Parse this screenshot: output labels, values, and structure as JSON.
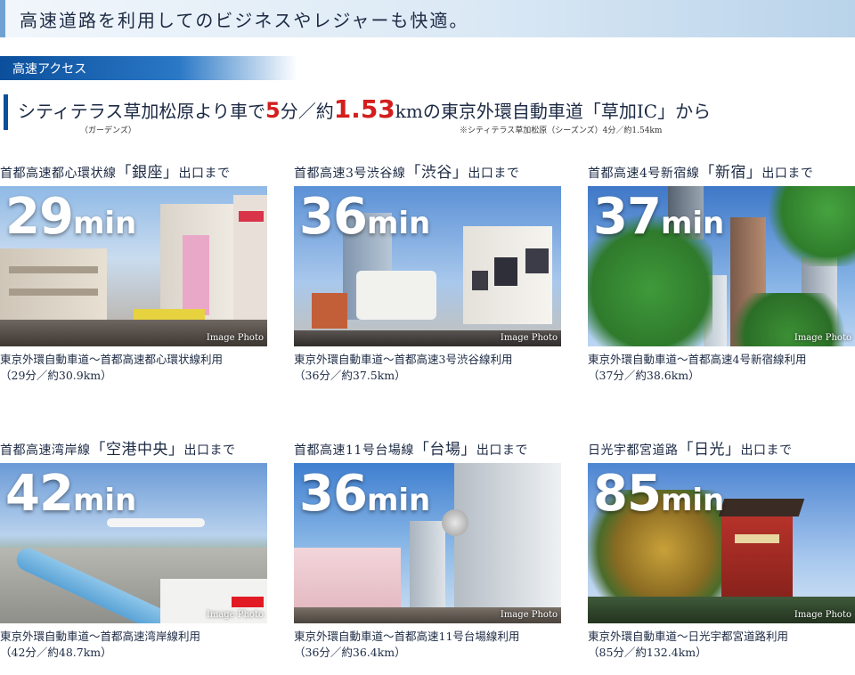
{
  "header": {
    "title": "高速道路を利用してのビジネスやレジャーも快適。"
  },
  "section": {
    "label": "高速アクセス"
  },
  "access": {
    "pre": "シティテラス草加松原より車で",
    "minutes": "5",
    "min_unit": "分／約",
    "km": "1.53",
    "post": "kmの東京外環自動車道「草加IC」から",
    "note_gardens": "（ガーデンズ）",
    "note_seasons": "※シティテラス草加松原（シーズンズ）4分／約1.54km"
  },
  "photo_tag": "Image Photo",
  "minute_unit": "min",
  "cards": [
    {
      "head_pre": "首都高速都心環状線",
      "head_big": "「銀座」",
      "head_post": "出口まで",
      "time": "29",
      "route": "東京外環自動車道～首都高速都心環状線利用",
      "detail": "（29分／約30.9km）"
    },
    {
      "head_pre": "首都高速3号渋谷線",
      "head_big": "「渋谷」",
      "head_post": "出口まで",
      "time": "36",
      "route": "東京外環自動車道～首都高速3号渋谷線利用",
      "detail": "（36分／約37.5km）"
    },
    {
      "head_pre": "首都高速4号新宿線",
      "head_big": "「新宿」",
      "head_post": "出口まで",
      "time": "37",
      "route": "東京外環自動車道～首都高速4号新宿線利用",
      "detail": "（37分／約38.6km）"
    },
    {
      "head_pre": "首都高速湾岸線",
      "head_big": "「空港中央」",
      "head_post": "出口まで",
      "time": "42",
      "route": "東京外環自動車道～首都高速湾岸線利用",
      "detail": "（42分／約48.7km）"
    },
    {
      "head_pre": "首都高速11号台場線",
      "head_big": "「台場」",
      "head_post": "出口まで",
      "time": "36",
      "route": "東京外環自動車道～首都高速11号台場線利用",
      "detail": "（36分／約36.4km）"
    },
    {
      "head_pre": "日光宇都宮道路",
      "head_big": "「日光」",
      "head_post": "出口まで",
      "time": "85",
      "route": "東京外環自動車道～日光宇都宮道路利用",
      "detail": "（85分／約132.4km）"
    }
  ]
}
